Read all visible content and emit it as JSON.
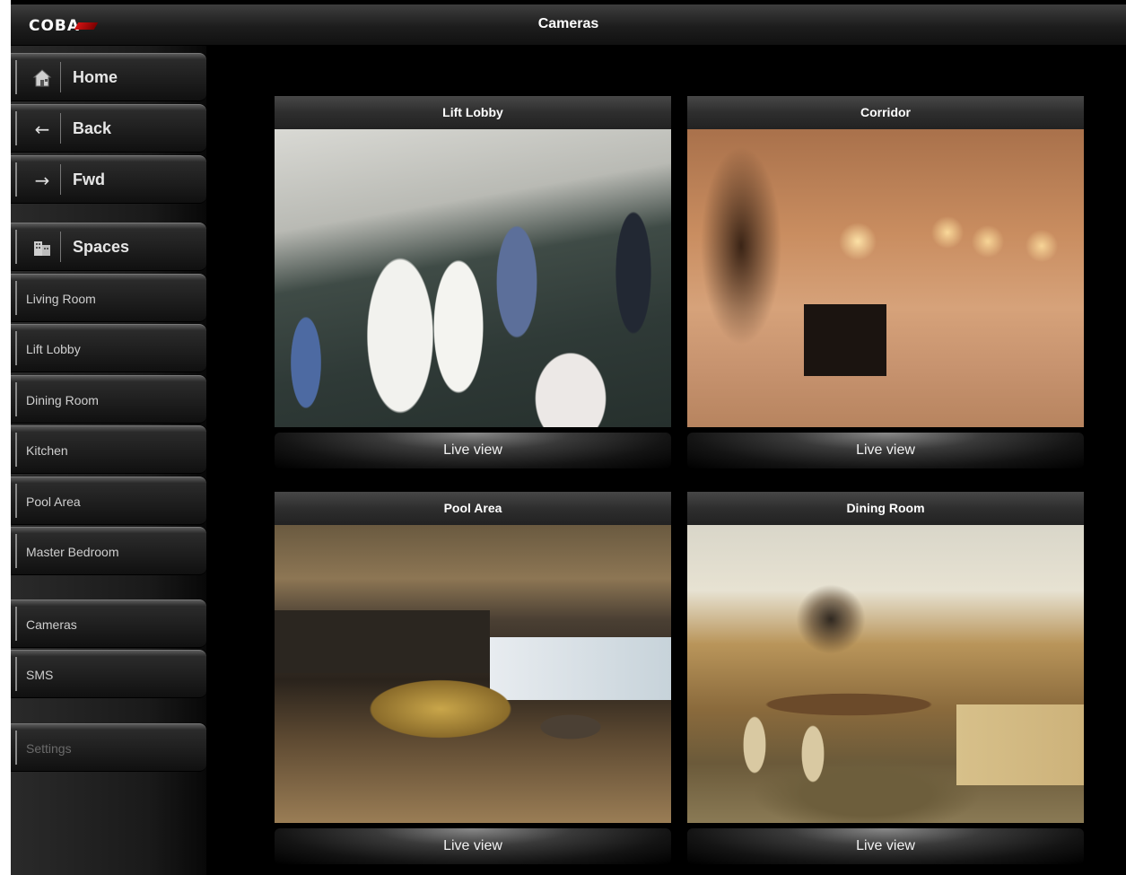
{
  "header": {
    "logo": "COBA",
    "title": "Cameras"
  },
  "sidebar": {
    "primary": [
      {
        "label": "Home",
        "icon": "home-icon"
      },
      {
        "label": "Back",
        "icon": "arrow-left-icon"
      },
      {
        "label": "Fwd",
        "icon": "arrow-right-icon"
      },
      {
        "label": "Spaces",
        "icon": "building-icon"
      }
    ],
    "rooms": [
      {
        "label": "Living Room"
      },
      {
        "label": "Lift Lobby"
      },
      {
        "label": "Dining Room"
      },
      {
        "label": "Kitchen"
      },
      {
        "label": "Pool Area"
      },
      {
        "label": "Master Bedroom"
      }
    ],
    "tools": [
      {
        "label": "Cameras"
      },
      {
        "label": "SMS"
      }
    ],
    "settings": {
      "label": "Settings",
      "state": "disabled"
    }
  },
  "cameras": [
    {
      "title": "Lift Lobby",
      "button": "Live view"
    },
    {
      "title": "Corridor",
      "button": "Live view"
    },
    {
      "title": "Pool Area",
      "button": "Live view"
    },
    {
      "title": "Dining Room",
      "button": "Live view"
    }
  ],
  "colors": {
    "logo_accent": "#d21212",
    "background": "#000000"
  }
}
